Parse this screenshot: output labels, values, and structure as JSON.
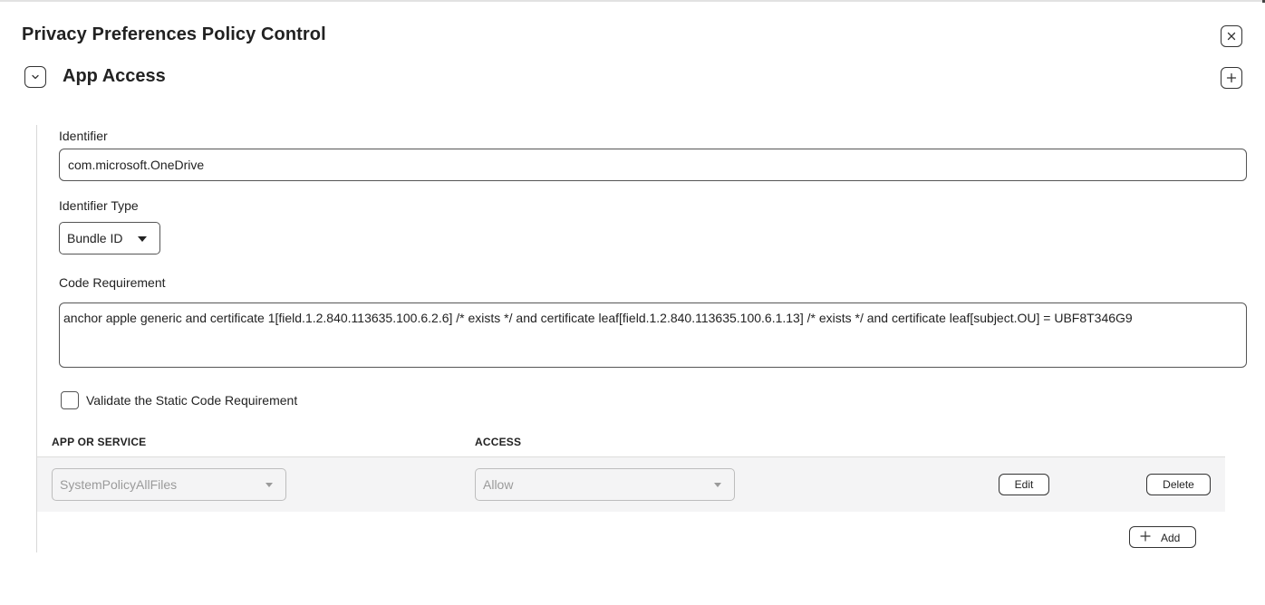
{
  "header": {
    "title": "Privacy Preferences Policy Control",
    "close_icon": "close-icon"
  },
  "section": {
    "title": "App Access",
    "collapse_icon": "chevron-down-icon",
    "add_icon": "plus-icon"
  },
  "form": {
    "identifier_label": "Identifier",
    "identifier_value": "com.microsoft.OneDrive",
    "identifier_type_label": "Identifier Type",
    "identifier_type_value": "Bundle ID",
    "code_requirement_label": "Code Requirement",
    "code_requirement_value": "anchor apple generic and certificate 1[field.1.2.840.113635.100.6.2.6] /* exists */ and certificate leaf[field.1.2.840.113635.100.6.1.13] /* exists */ and certificate leaf[subject.OU] = UBF8T346G9",
    "validate_label": "Validate the Static Code Requirement",
    "validate_checked": false
  },
  "table": {
    "columns": [
      "APP OR SERVICE",
      "ACCESS"
    ],
    "rows": [
      {
        "app_or_service": "SystemPolicyAllFiles",
        "access": "Allow",
        "edit_label": "Edit",
        "delete_label": "Delete"
      }
    ],
    "add_label": "Add"
  }
}
